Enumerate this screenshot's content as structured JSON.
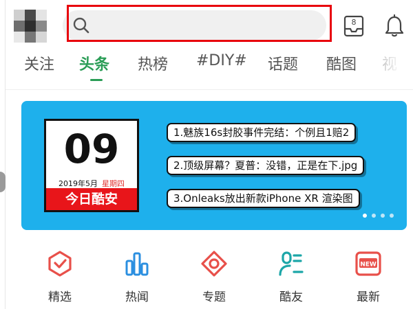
{
  "header": {
    "search_placeholder": "",
    "inbox_badge": "8"
  },
  "tabs": [
    {
      "label": "关注",
      "active": false
    },
    {
      "label": "头条",
      "active": true
    },
    {
      "label": "热榜",
      "active": false
    },
    {
      "label": "#DIY#",
      "active": false
    },
    {
      "label": "话题",
      "active": false
    },
    {
      "label": "酷图",
      "active": false
    }
  ],
  "banner": {
    "day": "09",
    "date": "2019年5月",
    "weekday": "星期四",
    "title": "今日酷安",
    "headlines": [
      "1.魅族16s封胶事件完结：个例且1赔2",
      "2.顶级屏幕？夏普：没错，正是在下.jpg",
      "3.Onleaks放出新款iPhone XR 渲染图"
    ],
    "page_count": 4,
    "active_page": 0
  },
  "nav": [
    {
      "label": "精选",
      "icon": "featured-icon",
      "color": "#e8504a"
    },
    {
      "label": "热闻",
      "icon": "hot-news-icon",
      "color": "#2b8fe0"
    },
    {
      "label": "专题",
      "icon": "topics-icon",
      "color": "#e8504a"
    },
    {
      "label": "酷友",
      "icon": "friends-icon",
      "color": "#1ca6a8"
    },
    {
      "label": "最新",
      "icon": "new-icon",
      "color": "#e8504a"
    }
  ],
  "colors": {
    "accent": "#2a9d56",
    "banner_bg": "#1eb0ec",
    "highlight": "#e8000b"
  }
}
